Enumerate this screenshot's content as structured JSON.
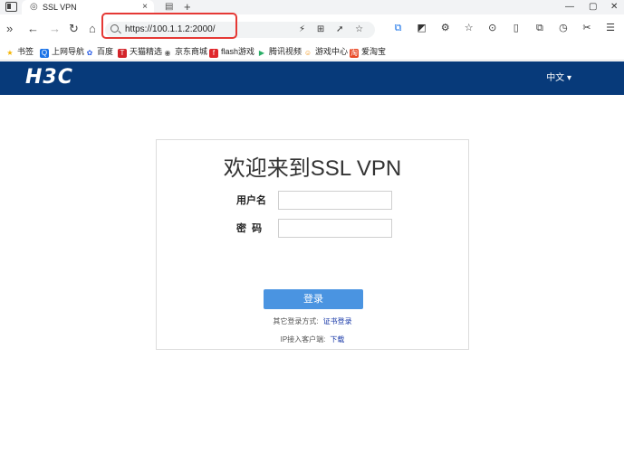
{
  "browser": {
    "tab_title": "SSL VPN",
    "tab_close": "×",
    "new_tab": "+",
    "window_controls": [
      "—",
      "▢",
      "✕"
    ],
    "url": "https://100.1.1.2:2000/",
    "nav": {
      "menu": "»",
      "back": "←",
      "forward": "→",
      "reload": "↻",
      "home": "⌂"
    },
    "addr_icons": [
      "⚡",
      "⊞",
      "➚",
      "☆"
    ],
    "toolbar_icons": [
      "⧉",
      "◩",
      "⚙",
      "☆",
      "⊙",
      "▯",
      "⧉",
      "◷",
      "✂",
      "☰",
      "👤"
    ],
    "bookmarks": [
      {
        "label": "书签",
        "icon_color": "#f5b400",
        "icon": "★"
      },
      {
        "label": "上网导航",
        "icon_color": "#1a73e8",
        "icon": "Q"
      },
      {
        "label": "百度",
        "icon_color": "#2b5ee8",
        "icon": "✿"
      },
      {
        "label": "天猫精选",
        "icon_color": "#d3242a",
        "icon": "T"
      },
      {
        "label": "京东商城",
        "icon_color": "#666666",
        "icon": "◉"
      },
      {
        "label": "flash游戏",
        "icon_color": "#e0262b",
        "icon": "f"
      },
      {
        "label": "腾讯视频",
        "icon_color": "#2aae67",
        "icon": "▶"
      },
      {
        "label": "游戏中心",
        "icon_color": "#f08a00",
        "icon": "☺"
      },
      {
        "label": "爱淘宝",
        "icon_color": "#e94b28",
        "icon": "淘"
      }
    ]
  },
  "header": {
    "logo": "H3C",
    "language": "中文 ▾",
    "bg_color": "#073a7a"
  },
  "login": {
    "title": "欢迎来到SSL VPN",
    "username_label": "用户名",
    "password_label": "密  码",
    "username_value": "",
    "password_value": "",
    "button": "登录",
    "other_methods_label": "其它登录方式:",
    "cert_login": "证书登录",
    "client_label": "IP接入客户端:",
    "download": "下载",
    "button_color": "#4a94e1"
  }
}
